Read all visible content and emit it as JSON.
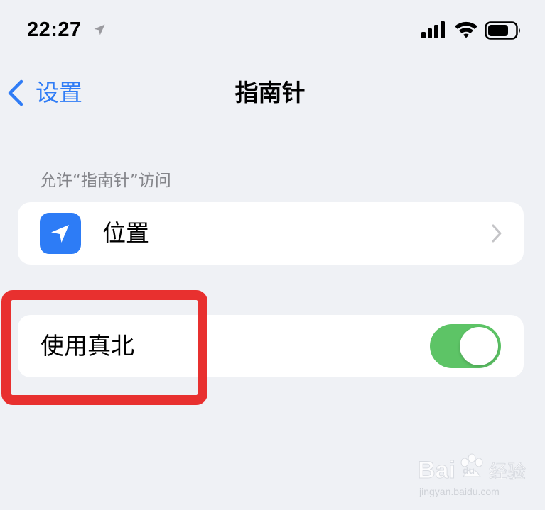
{
  "status_bar": {
    "time": "22:27",
    "location_icon": "location-arrow-icon",
    "signal_icon": "cellular-signal-icon",
    "wifi_icon": "wifi-icon",
    "battery_icon": "battery-icon"
  },
  "nav": {
    "back_label": "设置",
    "title": "指南针"
  },
  "section": {
    "header": "允许“指南针”访问"
  },
  "rows": {
    "location": {
      "label": "位置",
      "icon": "location-arrow-icon"
    },
    "true_north": {
      "label": "使用真北",
      "toggle_on": true
    }
  },
  "colors": {
    "accent": "#2f7cf6",
    "toggle_on": "#5dc466",
    "background": "#eff1f5",
    "highlight": "#e8302f"
  },
  "watermark": {
    "brand": "Bai",
    "brand_tail": "du",
    "product": "经验",
    "url": "jingyan.baidu.com"
  }
}
